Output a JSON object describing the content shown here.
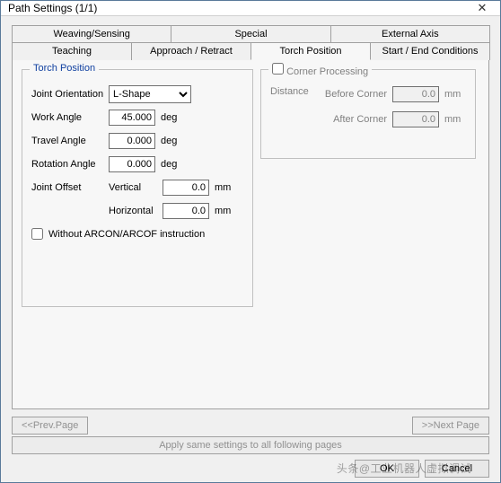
{
  "window": {
    "title": "Path Settings  (1/1)"
  },
  "tabs_row1": [
    {
      "label": "Weaving/Sensing"
    },
    {
      "label": "Special"
    },
    {
      "label": "External Axis"
    }
  ],
  "tabs_row2": [
    {
      "label": "Teaching"
    },
    {
      "label": "Approach / Retract"
    },
    {
      "label": "Torch Position"
    },
    {
      "label": "Start / End Conditions"
    }
  ],
  "torch": {
    "legend": "Torch Position",
    "joint_orientation_label": "Joint Orientation",
    "joint_orientation_value": "L-Shape",
    "work_angle_label": "Work Angle",
    "work_angle_value": "45.000",
    "travel_angle_label": "Travel Angle",
    "travel_angle_value": "0.000",
    "rotation_angle_label": "Rotation Angle",
    "rotation_angle_value": "0.000",
    "joint_offset_label": "Joint Offset",
    "vertical_label": "Vertical",
    "vertical_value": "0.0",
    "horizontal_label": "Horizontal",
    "horizontal_value": "0.0",
    "unit_deg": "deg",
    "unit_mm": "mm",
    "without_arcon_label": "Without ARCON/ARCOF instruction"
  },
  "corner": {
    "legend": "Corner Processing",
    "enable_checked": false,
    "distance_label": "Distance",
    "before_label": "Before Corner",
    "before_value": "0.0",
    "after_label": "After Corner",
    "after_value": "0.0",
    "unit_mm": "mm"
  },
  "nav": {
    "prev_label": "<<Prev.Page",
    "next_label": ">>Next Page",
    "apply_label": "Apply same settings to all following pages"
  },
  "footer": {
    "ok_label": "OK",
    "cancel_label": "Cancel"
  },
  "watermark": "头条@工业机器人虚拟调试"
}
